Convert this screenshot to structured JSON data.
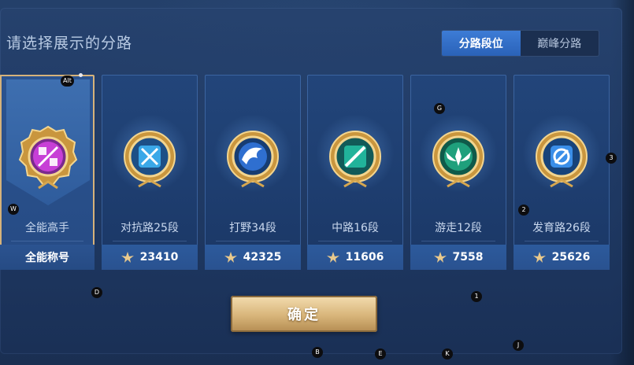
{
  "panel": {
    "title": "请选择展示的分路",
    "tabs": [
      {
        "label": "分路段位",
        "active": true
      },
      {
        "label": "巅峰分路",
        "active": false
      }
    ],
    "confirm_label": "确定"
  },
  "cards": [
    {
      "label": "全能高手",
      "footer": "全能称号",
      "selected": true,
      "badge": "all-rounder-emblem-icon",
      "color": "#c73fd6"
    },
    {
      "label": "对抗路25段",
      "footer": "23410",
      "selected": false,
      "badge": "clash-lane-emblem-icon",
      "color": "#3aa8e8"
    },
    {
      "label": "打野34段",
      "footer": "42325",
      "selected": false,
      "badge": "jungle-emblem-icon",
      "color": "#2f6fd0"
    },
    {
      "label": "中路16段",
      "footer": "11606",
      "selected": false,
      "badge": "mid-lane-emblem-icon",
      "color": "#21b39a"
    },
    {
      "label": "游走12段",
      "footer": "7558",
      "selected": false,
      "badge": "roam-emblem-icon",
      "color": "#1fa07c"
    },
    {
      "label": "发育路26段",
      "footer": "25626",
      "selected": false,
      "badge": "farm-lane-emblem-icon",
      "color": "#3a8ee8"
    }
  ],
  "hotkeys": [
    "Alt",
    "W",
    "G",
    "3",
    "2",
    "D",
    "1",
    "B",
    "E",
    "K",
    "J"
  ]
}
